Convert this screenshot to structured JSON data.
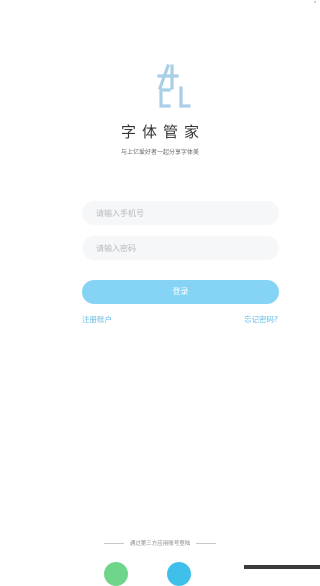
{
  "status": {
    "indicator": "'"
  },
  "brand": {
    "logo_icon": "acl-monogram-logo-icon",
    "app_name": "字体管家",
    "tagline": "与上亿爱好者一起分享字体美"
  },
  "form": {
    "phone_placeholder": "请输入手机号",
    "password_placeholder": "请输入密码",
    "login_label": "登录",
    "register_label": "注册账户",
    "forgot_label": "忘记密码?"
  },
  "third_party": {
    "label": "通过第三方应用账号登陆",
    "providers": [
      {
        "icon": "wechat-icon",
        "color": "#6ed58a"
      },
      {
        "icon": "qq-icon",
        "color": "#3ec0ea"
      }
    ]
  },
  "colors": {
    "accent": "#85d3f5",
    "link": "#5fbde8",
    "logo": "#a9cfe6"
  }
}
